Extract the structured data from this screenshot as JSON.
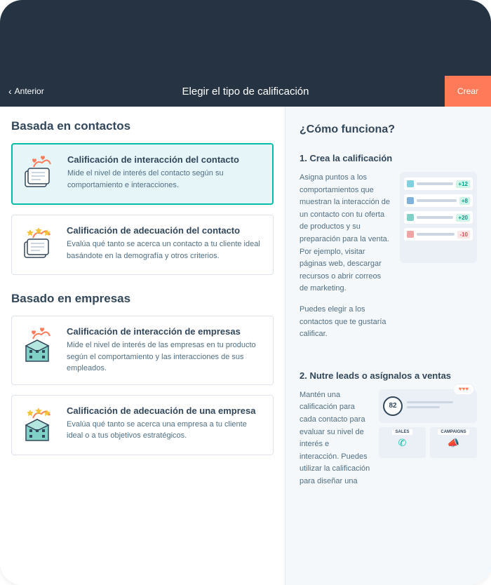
{
  "toolbar": {
    "back_label": "Anterior",
    "title": "Elegir el tipo de calificación",
    "create_label": "Crear"
  },
  "left": {
    "section1_heading": "Basada en contactos",
    "cards1": [
      {
        "title": "Calificación de interacción del contacto",
        "desc": "Mide el nivel de interés del contacto según su comportamiento e interacciones."
      },
      {
        "title": "Calificación de adecuación del contacto",
        "desc": "Evalúa qué tanto se acerca un contacto a tu cliente ideal basándote en la demografía y otros criterios."
      }
    ],
    "section2_heading": "Basado en empresas",
    "cards2": [
      {
        "title": "Calificación de interacción de empresas",
        "desc": "Mide el nivel de interés de las empresas en tu producto según el comportamiento y las interacciones de sus empleados."
      },
      {
        "title": "Calificación de adecuación de una empresa",
        "desc": "Evalúa qué tanto se acerca una empresa a tu cliente ideal o a tus objetivos estratégicos."
      }
    ]
  },
  "right": {
    "howto_title": "¿Cómo funciona?",
    "step1": {
      "title": "1. Crea la calificación",
      "text1": "Asigna puntos a los comportamientos que muestran la interacción de un contacto con tu oferta de productos y su preparación para la venta. Por ejemplo, visitar páginas web, descargar recursos o abrir correos de marketing.",
      "text2": "Puedes elegir a los contactos que te gustaría calificar.",
      "badges": [
        "+12",
        "+8",
        "+20",
        "-10"
      ]
    },
    "step2": {
      "title": "2. Nutre leads o asígnalos a ventas",
      "text": "Mantén una calificación para cada contacto para evaluar su nivel de interés e interacción. Puedes utilizar la calificación para diseñar una",
      "score": "82",
      "box1_label": "SALES",
      "box2_label": "CAMPAIGNS"
    }
  }
}
